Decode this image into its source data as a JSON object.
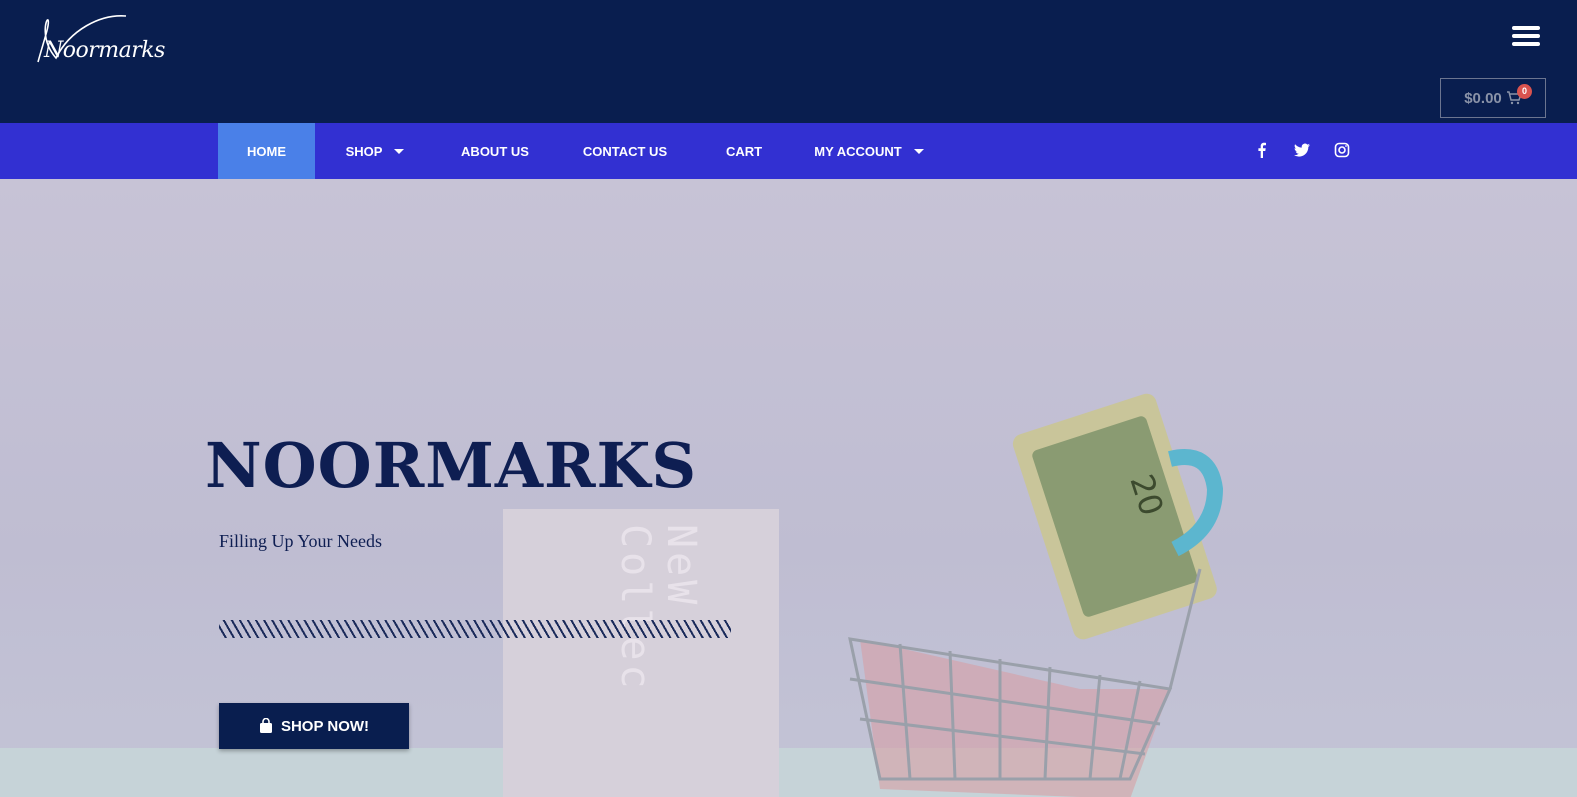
{
  "brand": {
    "logo_text": "Noormarks",
    "title": "NOORMARKS",
    "tagline": "Filling Up Your Needs"
  },
  "header": {
    "cart_total": "$0.00",
    "cart_count": "0"
  },
  "nav": {
    "items": [
      {
        "label": "HOME",
        "active": true
      },
      {
        "label": "SHOP",
        "has_dropdown": true
      },
      {
        "label": "ABOUT US"
      },
      {
        "label": "CONTACT US"
      },
      {
        "label": "CART"
      },
      {
        "label": "MY ACCOUNT",
        "has_dropdown": true
      }
    ],
    "social": [
      "facebook-icon",
      "twitter-icon",
      "instagram-icon"
    ]
  },
  "hero": {
    "cta_label": "SHOP NOW!",
    "card_text": "NeW Collec"
  },
  "colors": {
    "header_bg": "#091e4f",
    "nav_bg": "#3230d2",
    "active_nav": "#4a80e8"
  }
}
